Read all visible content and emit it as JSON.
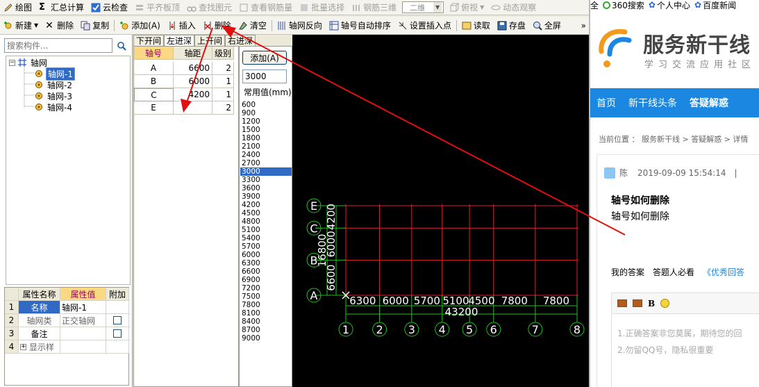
{
  "toolbar1": {
    "draw": "绘图",
    "sum": "汇总计算",
    "cloud": "云检查",
    "align": "平齐板顶",
    "find": "查找图元",
    "view_rebar": "查看钢筋量",
    "batch": "批量选择",
    "rebar3d": "钢筋三维",
    "dim_select": "二维",
    "view": "俯视",
    "dynamic": "动态观察"
  },
  "toolbar2": {
    "new": "新建",
    "delete": "删除",
    "copy": "复制",
    "add": "添加(A)",
    "insert": "插入",
    "delete2": "删除",
    "clear": "清空",
    "reverse": "轴网反向",
    "autosort": "轴号自动排序",
    "setpoint": "设置插入点",
    "read": "读取",
    "save": "存盘",
    "fullscreen": "全屏"
  },
  "left": {
    "search_placeholder": "搜索构件...",
    "tree_root": "轴网",
    "tree_items": [
      "轴网-1",
      "轴网-2",
      "轴网-3",
      "轴网-4"
    ],
    "prop_headers": [
      "属性名称",
      "属性值",
      "附加"
    ],
    "props": [
      {
        "n": "1",
        "k": "名称",
        "v": "轴网-1"
      },
      {
        "n": "2",
        "k": "轴网类",
        "v": "正交轴网"
      },
      {
        "n": "3",
        "k": "备注",
        "v": ""
      },
      {
        "n": "4",
        "k": "显示样",
        "v": ""
      }
    ]
  },
  "axis": {
    "tabs": [
      "下开间",
      "左进深",
      "上开间",
      "右进深"
    ],
    "headers": [
      "轴号",
      "轴距",
      "级别"
    ],
    "rows": [
      {
        "no": "A",
        "dist": "6600",
        "lvl": "2"
      },
      {
        "no": "B",
        "dist": "6000",
        "lvl": "1"
      },
      {
        "no": "C",
        "dist": "4200",
        "lvl": "1"
      },
      {
        "no": "E",
        "dist": "",
        "lvl": "2"
      }
    ]
  },
  "common": {
    "add_button": "添加(A)",
    "input_value": "3000",
    "label": "常用值(mm)",
    "values": [
      "600",
      "900",
      "1200",
      "1500",
      "1800",
      "2100",
      "2400",
      "2700",
      "3000",
      "3300",
      "3600",
      "3900",
      "4200",
      "4500",
      "4800",
      "5100",
      "5400",
      "5700",
      "6000",
      "6300",
      "6600",
      "6900",
      "7200",
      "7500",
      "7800",
      "8100",
      "8400",
      "8700",
      "9000"
    ],
    "selected": "3000"
  },
  "canvas": {
    "bottom_dims": [
      "6300",
      "6000",
      "5700",
      "5100",
      "4500",
      "7800",
      "7800"
    ],
    "bottom_total": "43200",
    "left_dims": [
      "6600",
      "6000",
      "4200"
    ],
    "left_total": "16800",
    "col_labels": [
      "1",
      "2",
      "3",
      "4",
      "5",
      "6",
      "7",
      "8"
    ],
    "row_labels": [
      "A",
      "B",
      "C",
      "E"
    ],
    "grid_color": "#e0202a",
    "dim_color": "#20c020",
    "arrow_color": "#e01010"
  },
  "web": {
    "bookmarks": [
      "全",
      "360搜索",
      "个人中心",
      "百度新闻"
    ],
    "brand": "服务新干线",
    "slogan": "学习交流应用社区",
    "nav": [
      "首页",
      "新干线头条",
      "答疑解惑"
    ],
    "crumb": "当前位置 ： 服务新干线 > 答疑解惑 > 详情",
    "meta_user": "陈",
    "meta_time": "2019-09-09 15:54:14",
    "title": "轴号如何删除",
    "body": "轴号如何删除",
    "answer_tabs": [
      "我的答案",
      "答题人必看",
      "《优秀回答"
    ],
    "editor_tips": [
      "1.正确答案非您莫属，期待您的回",
      "2.勿留QQ号，隐私很重要"
    ]
  }
}
